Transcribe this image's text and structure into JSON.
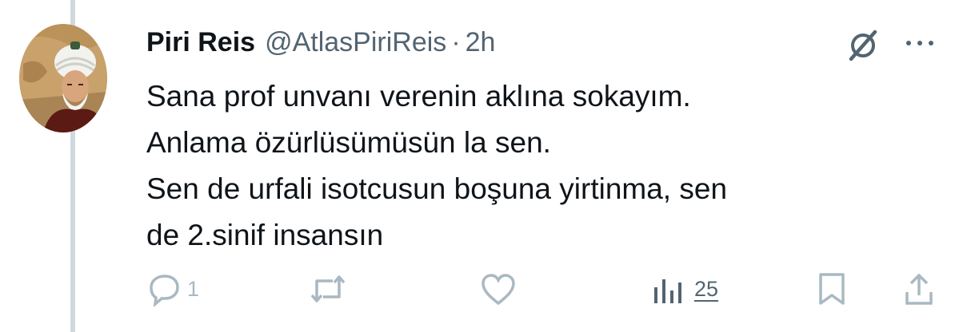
{
  "tweet": {
    "author_name": "Piri Reis",
    "handle": "@AtlasPiriReis",
    "separator": "·",
    "time": "2h",
    "lines": [
      "Sana prof unvanı verenin aklına sokayım.",
      "Anlama özürlüsümüsün la sen.",
      "Sen de urfali isotcusun boşuna yirtinma, sen",
      "de 2.sinif insansın"
    ],
    "reply_count": "1",
    "views_count": "25"
  },
  "icons": {
    "avatar": "portrait-avatar",
    "grok": "grok-icon",
    "more": "more-dots-icon",
    "reply": "reply-icon",
    "retweet": "retweet-icon",
    "like": "heart-icon",
    "views": "views-bar-chart-icon",
    "bookmark": "bookmark-icon",
    "share": "share-icon"
  },
  "colors": {
    "text": "#0f1419",
    "secondary": "#536471",
    "faded_icons": "#aab8c2",
    "thread_line": "#cfd9de"
  }
}
